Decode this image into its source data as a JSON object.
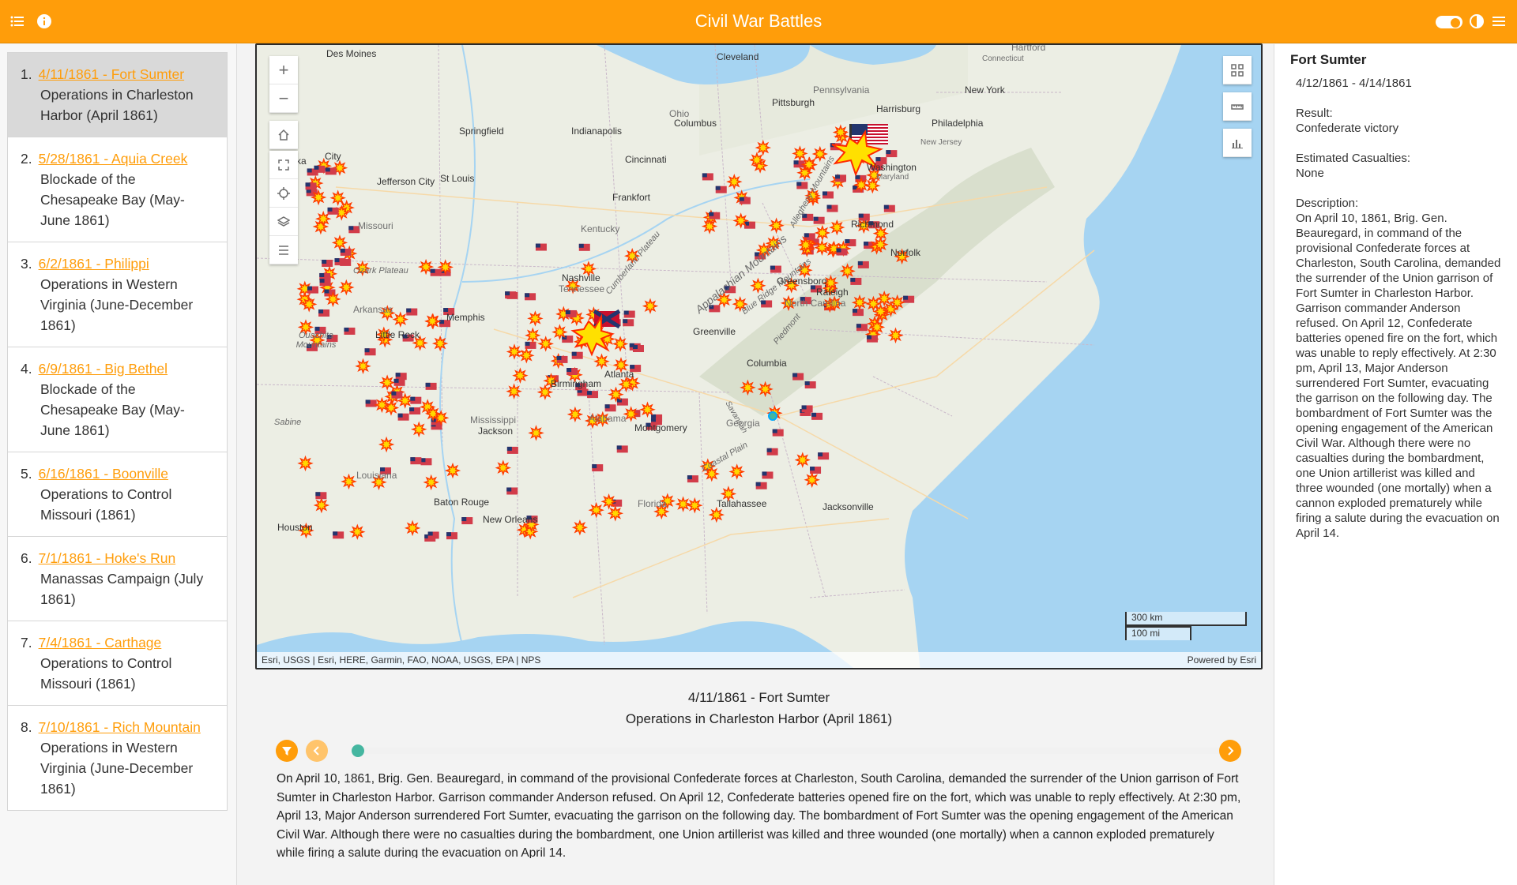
{
  "header": {
    "title": "Civil War Battles",
    "icons": [
      "list-icon",
      "info-icon",
      "toggle-switch",
      "contrast-icon",
      "menu-icon"
    ]
  },
  "battles": [
    {
      "num": "1.",
      "link": "4/11/1861 - Fort Sumter",
      "desc": "Operations in Charleston Harbor (April 1861)",
      "active": true
    },
    {
      "num": "2.",
      "link": "5/28/1861 - Aquia Creek",
      "desc": "Blockade of the Chesapeake Bay (May-June 1861)"
    },
    {
      "num": "3.",
      "link": "6/2/1861 - Philippi",
      "desc": "Operations in Western Virginia (June-December 1861)"
    },
    {
      "num": "4.",
      "link": "6/9/1861 - Big Bethel",
      "desc": "Blockade of the Chesapeake Bay (May-June 1861)"
    },
    {
      "num": "5.",
      "link": "6/16/1861 - Boonville",
      "desc": "Operations to Control Missouri (1861)"
    },
    {
      "num": "6.",
      "link": "7/1/1861 - Hoke's Run",
      "desc": "Manassas Campaign (July 1861)"
    },
    {
      "num": "7.",
      "link": "7/4/1861 - Carthage",
      "desc": "Operations to Control Missouri (1861)"
    },
    {
      "num": "8.",
      "link": "7/10/1861 - Rich Mountain",
      "desc": "Operations in Western Virginia (June-December 1861)"
    }
  ],
  "map": {
    "attribution": "Esri, USGS | Esri, HERE, Garmin, FAO, NOAA, USGS, EPA | NPS",
    "powered_by": "Powered by Esri",
    "scale_km": "300 km",
    "scale_mi": "100 mi",
    "cities": [
      {
        "name": "Des Moines"
      },
      {
        "name": "Cleveland"
      },
      {
        "name": "Hartford"
      },
      {
        "name": "Connecticut"
      },
      {
        "name": "Pennsylvania"
      },
      {
        "name": "New York"
      },
      {
        "name": "Pittsburgh"
      },
      {
        "name": "Harrisburg"
      },
      {
        "name": "Philadelphia"
      },
      {
        "name": "Ohio"
      },
      {
        "name": "Columbus"
      },
      {
        "name": "Springfield"
      },
      {
        "name": "Indianapolis"
      },
      {
        "name": "New Jersey"
      },
      {
        "name": "Cincinnati"
      },
      {
        "name": "Topeka"
      },
      {
        "name": "City"
      },
      {
        "name": "Jefferson City"
      },
      {
        "name": "St Louis"
      },
      {
        "name": "Washington"
      },
      {
        "name": "Maryland"
      },
      {
        "name": "Frankfort"
      },
      {
        "name": "Missouri"
      },
      {
        "name": "Kentucky"
      },
      {
        "name": "Richmond"
      },
      {
        "name": "Norfolk"
      },
      {
        "name": "Ozark Plateau"
      },
      {
        "name": "Nashville"
      },
      {
        "name": "Tennessee"
      },
      {
        "name": "Greensboro"
      },
      {
        "name": "Raleigh"
      },
      {
        "name": "Arkansas"
      },
      {
        "name": "Memphis"
      },
      {
        "name": "North Carolina"
      },
      {
        "name": "Little Rock"
      },
      {
        "name": "Ouachita Mountains"
      },
      {
        "name": "Greenville"
      },
      {
        "name": "Columbia"
      },
      {
        "name": "Birmingham"
      },
      {
        "name": "Atlanta"
      },
      {
        "name": "Mississippi"
      },
      {
        "name": "Jackson"
      },
      {
        "name": "Alabama"
      },
      {
        "name": "Montgomery"
      },
      {
        "name": "Georgia"
      },
      {
        "name": "Sabine"
      },
      {
        "name": "Louisiana"
      },
      {
        "name": "Baton Rouge"
      },
      {
        "name": "Florida"
      },
      {
        "name": "Tallahassee"
      },
      {
        "name": "Jacksonville"
      },
      {
        "name": "New Orleans"
      },
      {
        "name": "Houston"
      },
      {
        "name": "Coastal Plain"
      },
      {
        "name": "Cumberland Plateau"
      },
      {
        "name": "Appalachian Mountains"
      },
      {
        "name": "Blue Ridge Mountains"
      },
      {
        "name": "Piedmont"
      },
      {
        "name": "Allegheny Mountains"
      },
      {
        "name": "Savannah"
      }
    ]
  },
  "detail": {
    "title": "Fort Sumter",
    "dates": "4/12/1861 - 4/14/1861",
    "result_label": "Result:",
    "result": "Confederate victory",
    "casualties_label": "Estimated Casualties:",
    "casualties": "None",
    "description_label": "Description:",
    "description": "On April 10, 1861, Brig. Gen. Beauregard, in command of the provisional Confederate forces at Charleston, South Carolina, demanded the surrender of the Union garrison of Fort Sumter in Charleston Harbor. Garrison commander Anderson refused. On April 12, Confederate batteries opened fire on the fort, which was unable to reply effectively. At 2:30 pm, April 13, Major Anderson surrendered Fort Sumter, evacuating the garrison on the following day. The bombardment of Fort Sumter was the opening engagement of the American Civil War. Although there were no casualties during the bombardment, one Union artillerist was killed and three wounded (one mortally) when a cannon exploded prematurely while firing a salute during the evacuation on April 14."
  },
  "bottom": {
    "title": "4/11/1861 - Fort Sumter",
    "subtitle": "Operations in Charleston Harbor (April 1861)",
    "slider_progress": 0.0,
    "description": "On April 10, 1861, Brig. Gen. Beauregard, in command of the provisional Confederate forces at Charleston, South Carolina, demanded the surrender of the Union garrison of Fort Sumter in Charleston Harbor. Garrison commander Anderson refused. On April 12, Confederate batteries opened fire on the fort, which was unable to reply effectively. At 2:30 pm, April 13, Major Anderson surrendered Fort Sumter, evacuating the garrison on the following day. The bombardment of Fort Sumter was the opening engagement of the American Civil War. Although there were no casualties during the bombardment, one Union artillerist was killed and three wounded (one mortally) when a cannon exploded prematurely while firing a salute during the evacuation on April 14."
  },
  "colors": {
    "accent": "#ff9d0a",
    "thumb": "#45b6a0",
    "water": "#a6d4f2"
  }
}
